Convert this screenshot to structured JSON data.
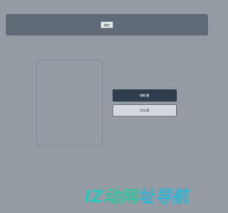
{
  "header": {
    "button_label": "确定"
  },
  "actions": {
    "primary_label": "随机看",
    "secondary_label": "应该看"
  },
  "watermark": {
    "part1": "IZ",
    "part2": "动网",
    "part3": "址导航"
  },
  "colors": {
    "background": "#949ba3",
    "header_bar": "#606a76",
    "primary_button": "#303d4f",
    "secondary_button": "#d4d7db",
    "watermark_teal": "#22c8c0"
  }
}
